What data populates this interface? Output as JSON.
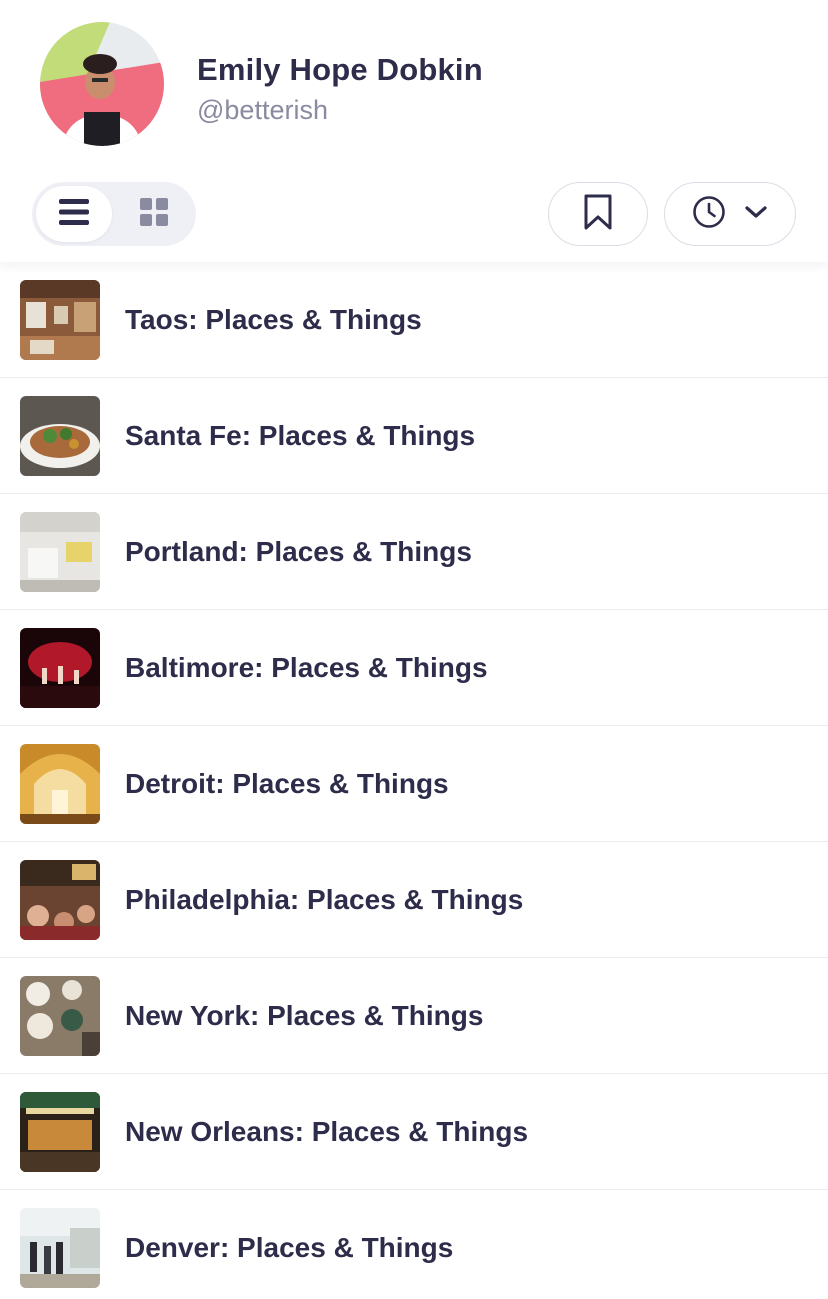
{
  "profile": {
    "name": "Emily Hope Dobkin",
    "handle": "@betterish"
  },
  "toolbar": {
    "list_view_icon": "list-icon",
    "grid_view_icon": "grid-icon",
    "bookmark_icon": "bookmark-icon",
    "sort_icon": "clock-icon",
    "sort_dropdown_icon": "chevron-down-icon"
  },
  "colors": {
    "text_primary": "#2d2c4a",
    "text_secondary": "#8a8aa0",
    "toggle_bg": "#eef0f6",
    "divider": "#ececf0"
  },
  "collections": [
    {
      "title": "Taos: Places & Things"
    },
    {
      "title": "Santa Fe: Places & Things"
    },
    {
      "title": "Portland: Places & Things"
    },
    {
      "title": "Baltimore: Places & Things"
    },
    {
      "title": "Detroit: Places & Things"
    },
    {
      "title": "Philadelphia: Places & Things"
    },
    {
      "title": "New York: Places & Things"
    },
    {
      "title": "New Orleans: Places & Things"
    },
    {
      "title": "Denver: Places & Things"
    }
  ]
}
